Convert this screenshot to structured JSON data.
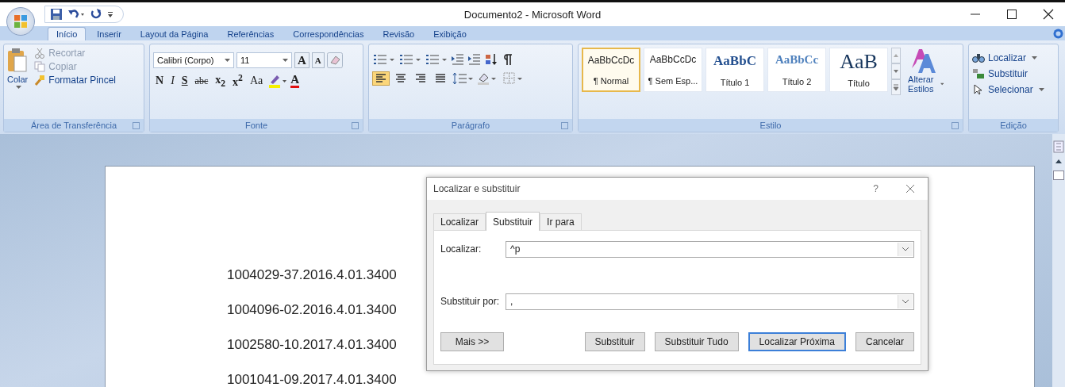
{
  "window": {
    "title": "Documento2 - Microsoft Word"
  },
  "tabs": [
    {
      "label": "Início",
      "selected": true
    },
    {
      "label": "Inserir",
      "selected": false
    },
    {
      "label": "Layout da Página",
      "selected": false
    },
    {
      "label": "Referências",
      "selected": false
    },
    {
      "label": "Correspondências",
      "selected": false
    },
    {
      "label": "Revisão",
      "selected": false
    },
    {
      "label": "Exibição",
      "selected": false
    }
  ],
  "ribbon": {
    "clipboard": {
      "name": "Área de Transferência",
      "paste": "Colar",
      "commands": [
        {
          "label": "Recortar",
          "disabled": true
        },
        {
          "label": "Copiar",
          "disabled": true
        },
        {
          "label": "Formatar Pincel",
          "disabled": false
        }
      ]
    },
    "font": {
      "name": "Fonte",
      "font_name": "Calibri (Corpo)",
      "font_size": "11",
      "grow": "A",
      "shrink": "A",
      "format_buttons": [
        {
          "kind": "bold",
          "label": "N"
        },
        {
          "kind": "italic",
          "label": "I"
        },
        {
          "kind": "underline",
          "label": "S"
        },
        {
          "kind": "strike",
          "label": "abc"
        },
        {
          "kind": "sub",
          "label": "x$_{2}$"
        },
        {
          "kind": "super",
          "label": "x$^{2}$"
        },
        {
          "kind": "case",
          "label": "Aa"
        }
      ],
      "color_button": "A"
    },
    "paragraph": {
      "name": "Parágrafo",
      "align_buttons": [
        {
          "selected": true
        },
        {
          "selected": false
        },
        {
          "selected": false
        },
        {
          "selected": false
        }
      ]
    },
    "styles": {
      "name": "Estilo",
      "items": [
        {
          "kind": "body",
          "sample": "AaBbCcDc",
          "label": "¶ Normal",
          "selected": true
        },
        {
          "kind": "body",
          "sample": "AaBbCcDc",
          "label": "¶ Sem Esp...",
          "selected": false
        },
        {
          "kind": "heading1",
          "sample": "AaBbC",
          "label": "Título 1",
          "selected": false
        },
        {
          "kind": "heading2",
          "sample": "AaBbCc",
          "label": "Título 2",
          "selected": false
        },
        {
          "kind": "title",
          "sample": "AaB",
          "label": "Título",
          "selected": false
        }
      ],
      "change": "Alterar Estilos"
    },
    "editing": {
      "name": "Edição",
      "commands": [
        {
          "kind": "find",
          "label": "Localizar",
          "dropdown": true
        },
        {
          "kind": "replace",
          "label": "Substituir",
          "dropdown": false
        },
        {
          "kind": "select",
          "label": "Selecionar",
          "dropdown": true
        }
      ]
    }
  },
  "document": {
    "lines": [
      "1004029-37.2016.4.01.3400",
      "1004096-02.2016.4.01.3400",
      "1002580-10.2017.4.01.3400",
      "1001041-09.2017.4.01.3400"
    ]
  },
  "dialog": {
    "title": "Localizar e substituir",
    "help": "?",
    "tabs": [
      {
        "label": "Localizar",
        "selected": false
      },
      {
        "label": "Substituir",
        "selected": true
      },
      {
        "label": "Ir para",
        "selected": false
      }
    ],
    "fields": [
      {
        "label": "Localizar:",
        "value": "^p"
      },
      {
        "label": "Substituir por:",
        "value": ","
      }
    ],
    "buttons": [
      {
        "label": "Mais >>",
        "kind": "more",
        "default": false
      },
      {
        "label": "Substituir",
        "kind": "action",
        "default": false
      },
      {
        "label": "Substituir Tudo",
        "kind": "action",
        "default": false
      },
      {
        "label": "Localizar Próxima",
        "kind": "action",
        "default": true
      },
      {
        "label": "Cancelar",
        "kind": "action",
        "default": false
      }
    ]
  }
}
